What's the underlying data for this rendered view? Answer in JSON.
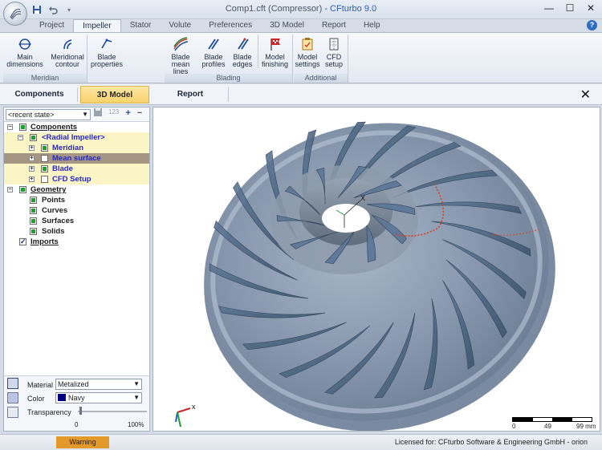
{
  "window": {
    "title": "Comp1.cft (Compressor) - ",
    "brand": "CFturbo 9.0",
    "controls": {
      "minimize": "—",
      "maximize": "☐",
      "close": "✕"
    }
  },
  "quick_access": {
    "save_icon": "save-icon",
    "undo_icon": "undo-icon"
  },
  "ribbon_tabs": [
    "Project",
    "Impeller",
    "Stator",
    "Volute",
    "Preferences",
    "3D Model",
    "Report",
    "Help"
  ],
  "active_ribbon_tab": "Impeller",
  "ribbon": {
    "groups": [
      {
        "label": "Meridian",
        "buttons": [
          {
            "label": "Main\ndimensions",
            "icon": "main-dimensions-icon"
          },
          {
            "label": "Meridional\ncontour",
            "icon": "meridional-contour-icon"
          }
        ]
      },
      {
        "label": "",
        "buttons": [
          {
            "label": "Blade\nproperties",
            "icon": "blade-properties-icon"
          }
        ]
      },
      {
        "label": "Blading",
        "buttons": [
          {
            "label": "Blade\nmean lines",
            "icon": "blade-mean-lines-icon"
          },
          {
            "label": "Blade\nprofiles",
            "icon": "blade-profiles-icon"
          },
          {
            "label": "Blade\nedges",
            "icon": "blade-edges-icon"
          },
          {
            "label": "Model\nfinishing",
            "icon": "model-finishing-icon"
          }
        ]
      },
      {
        "label": "Additional",
        "buttons": [
          {
            "label": "Model\nsettings",
            "icon": "model-settings-icon"
          },
          {
            "label": "CFD\nsetup",
            "icon": "cfd-setup-icon"
          }
        ]
      }
    ]
  },
  "subtabs": [
    "Components",
    "3D Model",
    "Report"
  ],
  "active_subtab": "3D Model",
  "state_selector": {
    "value": "<recent state>",
    "number_label": "123"
  },
  "tree": [
    {
      "label": "Components",
      "level": 0,
      "expander": "−",
      "check": "on",
      "style": "link"
    },
    {
      "label": "<Radial Impeller>",
      "level": 1,
      "expander": "−",
      "check": "on",
      "style": "blue",
      "bg": "yellow"
    },
    {
      "label": "Meridian",
      "level": 2,
      "expander": "+",
      "check": "on",
      "style": "blue",
      "bg": "yellow"
    },
    {
      "label": "Mean surface",
      "level": 2,
      "expander": "+",
      "check": "off",
      "style": "blue",
      "bg": "selected"
    },
    {
      "label": "Blade",
      "level": 2,
      "expander": "+",
      "check": "on",
      "style": "blue",
      "bg": "yellow"
    },
    {
      "label": "CFD Setup",
      "level": 2,
      "expander": "+",
      "check": "off",
      "style": "blue",
      "bg": "yellow"
    },
    {
      "label": "Geometry",
      "level": 0,
      "expander": "−",
      "check": "on",
      "style": "link"
    },
    {
      "label": "Points",
      "level": 1,
      "expander": "",
      "check": "on",
      "style": "plain"
    },
    {
      "label": "Curves",
      "level": 1,
      "expander": "",
      "check": "on",
      "style": "plain"
    },
    {
      "label": "Surfaces",
      "level": 1,
      "expander": "",
      "check": "on",
      "style": "plain"
    },
    {
      "label": "Solids",
      "level": 1,
      "expander": "",
      "check": "on",
      "style": "plain"
    },
    {
      "label": "Imports",
      "level": 0,
      "expander": "",
      "check": "tick",
      "style": "link"
    }
  ],
  "properties": {
    "material_label": "Material",
    "material_value": "Metalized",
    "color_label": "Color",
    "color_value": "Navy",
    "color_hex": "#000080",
    "transparency_label": "Transparency",
    "transparency_min": "0",
    "transparency_max": "100%",
    "transparency_value": 0
  },
  "viewport": {
    "scale_labels": [
      "0",
      "49",
      "99 mm"
    ],
    "axis_labels": {
      "x": "x",
      "triad_x": "X"
    }
  },
  "status": {
    "warning": "Warning",
    "license": "Licensed for: CFturbo Software & Engineering GmbH - orion"
  },
  "colors": {
    "accent_tab": "#f8d36c",
    "warning": "#e39a2a",
    "tree_selected": "#a59684",
    "tree_yellow": "#fbf5c5",
    "impeller_body": "#8898ad"
  }
}
